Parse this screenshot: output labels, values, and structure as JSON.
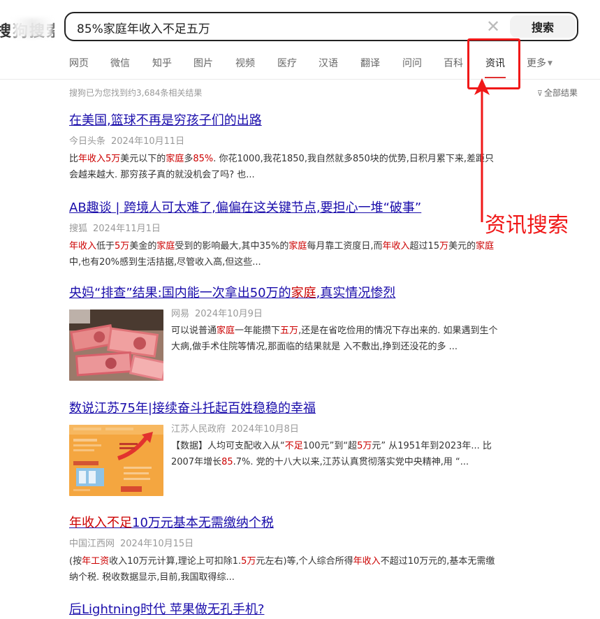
{
  "logo": {
    "text": "搜狗搜索"
  },
  "search": {
    "query": "85%家庭年收入不足五万",
    "button_label": "搜索",
    "clear_glyph": "✕"
  },
  "tabs": [
    {
      "label": "网页"
    },
    {
      "label": "微信"
    },
    {
      "label": "知乎"
    },
    {
      "label": "图片"
    },
    {
      "label": "视频"
    },
    {
      "label": "医疗"
    },
    {
      "label": "汉语"
    },
    {
      "label": "翻译"
    },
    {
      "label": "问问"
    },
    {
      "label": "百科"
    },
    {
      "label": "资讯",
      "active": true
    },
    {
      "label": "更多"
    }
  ],
  "result_count": "搜狗已为您找到约3,684条相关结果",
  "filter_label": "全部结果",
  "results": [
    {
      "title": "在美国,篮球不再是穷孩子们的出路",
      "source": "今日头条",
      "date": "2024年10月11日",
      "snippet": "比<em>年收入5万</em>美元以下的<em>家庭</em>多<em>85%</em>. 你花1000,我花1850,我自然就多850块的优势,日积月累下来,差距只会越来越大. 那穷孩子真的就没机会了吗? 也..."
    },
    {
      "title": "AB趣谈 | 跨境人可太难了,偏偏在这关键节点,要担心一堆“破事”",
      "source": "搜狐",
      "date": "2024年11月1日",
      "snippet": "<em>年收入</em>低于<em>5万</em>美金的<em>家庭</em>受到的影响最大,其中35%的<em>家庭</em>每月靠工资度日,而<em>年收入</em>超过15<em>万</em>美元的<em>家庭</em>中,也有20%感到生活拮据,尽管收入高,但这些..."
    },
    {
      "title": "央妈“排查”结果:国内能一次拿出50万的<em>家庭</em>,真实情况惨烈",
      "source": "网易",
      "date": "2024年10月9日",
      "snippet": "可以说普通<em>家庭</em>一年能攒下<em>五万</em>,还是在省吃俭用的情况下存出来的. 如果遇到生个大病,做手术住院等情况,那面临的结果就是 入不敷出,挣到还没花的多 ..."
    },
    {
      "title": "数说江苏75年|接续奋斗托起百姓稳稳的幸福",
      "source": "江苏人民政府",
      "date": "2024年10月8日",
      "snippet": "【数据】人均可支配收入从“<em>不足</em>100元”到“超<em>5万</em>元” 从1951年到2023年... 比2007年增长<em>85</em>.7%. 党的十八大以来,江苏认真贯彻落实党中央精神,用 “..."
    },
    {
      "title": "<em>年收入不足</em>10万元基本无需缴纳个税",
      "source": "中国江西网",
      "date": "2024年10月15日",
      "snippet": "(按<em>年工资</em>收入10万元计算,理论上可扣除1.<em>5万</em>元左右)等,个人综合所得<em>年收入</em>不超过10万元的,基本无需缴纳个税. 税收数据显示,目前,我国取得综..."
    },
    {
      "title": "后Lightning时代 苹果做无孔手机?"
    }
  ],
  "annotation": {
    "label": "资讯搜索"
  },
  "colors": {
    "link": "#1a0dab",
    "highlight": "#c00000",
    "annotation": "#f01818"
  }
}
